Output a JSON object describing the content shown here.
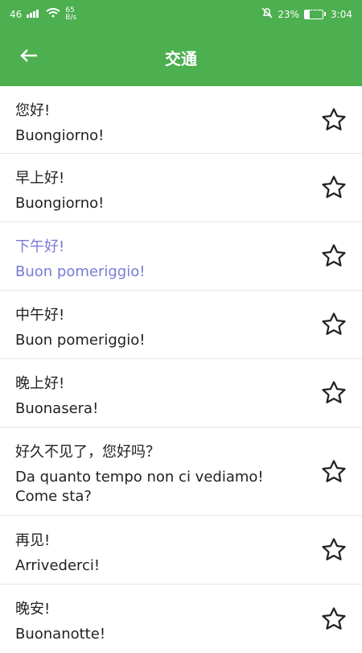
{
  "status_bar": {
    "signal_text": "46",
    "net_speed_value": "65",
    "net_speed_unit": "B/s",
    "battery_percent": "23%",
    "battery_icon_text": "23",
    "time": "3:04"
  },
  "app_bar": {
    "title": "交通"
  },
  "phrases": [
    {
      "zh": "您好!",
      "it": "Buongiorno!"
    },
    {
      "zh": "早上好!",
      "it": "Buongiorno!"
    },
    {
      "zh": "下午好!",
      "it": "Buon pomeriggio!"
    },
    {
      "zh": "中午好!",
      "it": "Buon pomeriggio!"
    },
    {
      "zh": "晚上好!",
      "it": "Buonasera!"
    },
    {
      "zh": "好久不见了，您好吗？",
      "it": "Da quanto tempo non ci vediamo! Come sta?"
    },
    {
      "zh": "再见!",
      "it": "Arrivederci!"
    },
    {
      "zh": "晚安!",
      "it": "Buonanotte!"
    }
  ],
  "colors": {
    "header": "#4caf50",
    "selected_text": "#7a7ad6",
    "divider": "#e6e6e6"
  },
  "icons": {
    "back": "arrow-left-icon",
    "favorite": "star-outline-icon"
  }
}
